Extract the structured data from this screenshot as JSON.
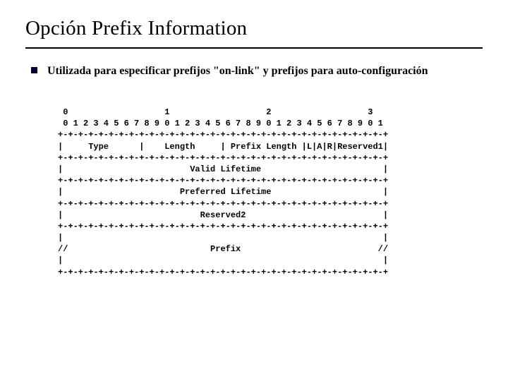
{
  "title": "Opción Prefix Information",
  "bullet": "Utilizada para especificar prefijos \"on-link\" y prefijos para auto-configuración",
  "diagram": {
    "ruler_tens": " 0                   1                   2                   3",
    "ruler_units": " 0 1 2 3 4 5 6 7 8 9 0 1 2 3 4 5 6 7 8 9 0 1 2 3 4 5 6 7 8 9 0 1",
    "sep": "+-+-+-+-+-+-+-+-+-+-+-+-+-+-+-+-+-+-+-+-+-+-+-+-+-+-+-+-+-+-+-+-+",
    "row_type": "|     Type      |    Length     | Prefix Length |L|A|R|Reserved1|",
    "row_valid": "|                         Valid Lifetime                        |",
    "row_pref": "|                       Preferred Lifetime                      |",
    "row_res2": "|                           Reserved2                           |",
    "row_blank": "|                                                               |",
    "row_prefix": "//                            Prefix                           //"
  }
}
